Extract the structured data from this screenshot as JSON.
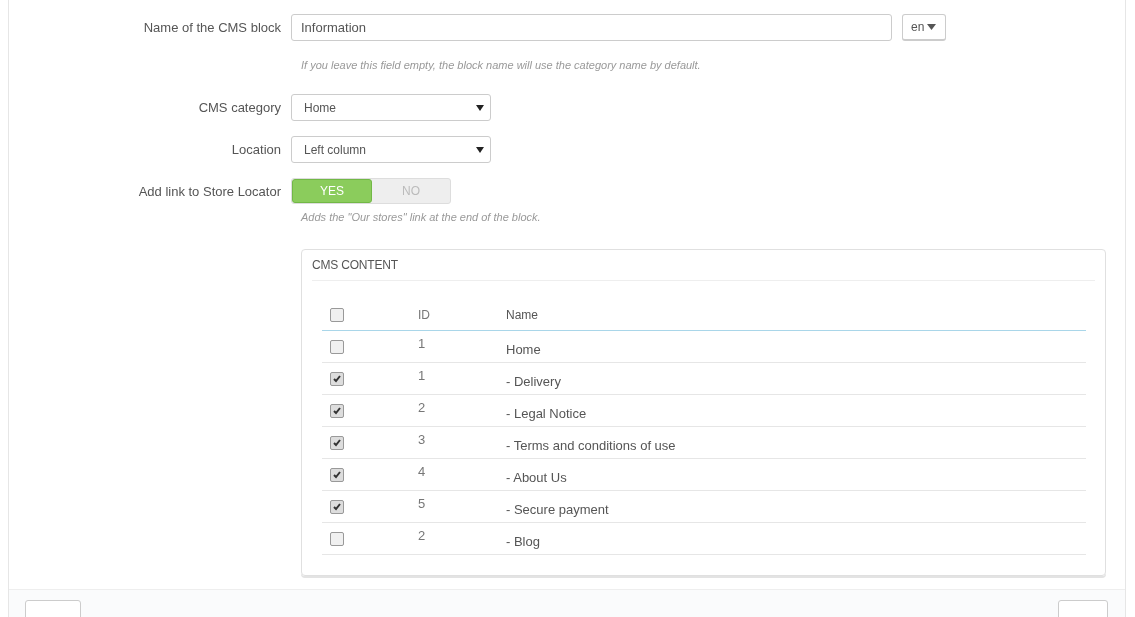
{
  "form": {
    "block_name": {
      "label": "Name of the CMS block",
      "value": "Information",
      "language": "en",
      "help": "If you leave this field empty, the block name will use the category name by default."
    },
    "category": {
      "label": "CMS category",
      "value": "Home"
    },
    "location": {
      "label": "Location",
      "value": "Left column"
    },
    "store_locator": {
      "label": "Add link to Store Locator",
      "options": [
        {
          "label": "YES",
          "selected": true
        },
        {
          "label": "NO",
          "selected": false
        }
      ],
      "help": "Adds the \"Our stores\" link at the end of the block."
    }
  },
  "cms_content": {
    "title": "CMS CONTENT",
    "select_all_checked": false,
    "columns": [
      "ID",
      "Name"
    ],
    "rows": [
      {
        "checked": false,
        "id": "1",
        "name": "Home"
      },
      {
        "checked": true,
        "id": "1",
        "name": "- Delivery"
      },
      {
        "checked": true,
        "id": "2",
        "name": "- Legal Notice"
      },
      {
        "checked": true,
        "id": "3",
        "name": "- Terms and conditions of use"
      },
      {
        "checked": true,
        "id": "4",
        "name": "- About Us"
      },
      {
        "checked": true,
        "id": "5",
        "name": "- Secure payment"
      },
      {
        "checked": false,
        "id": "2",
        "name": "- Blog"
      }
    ]
  }
}
